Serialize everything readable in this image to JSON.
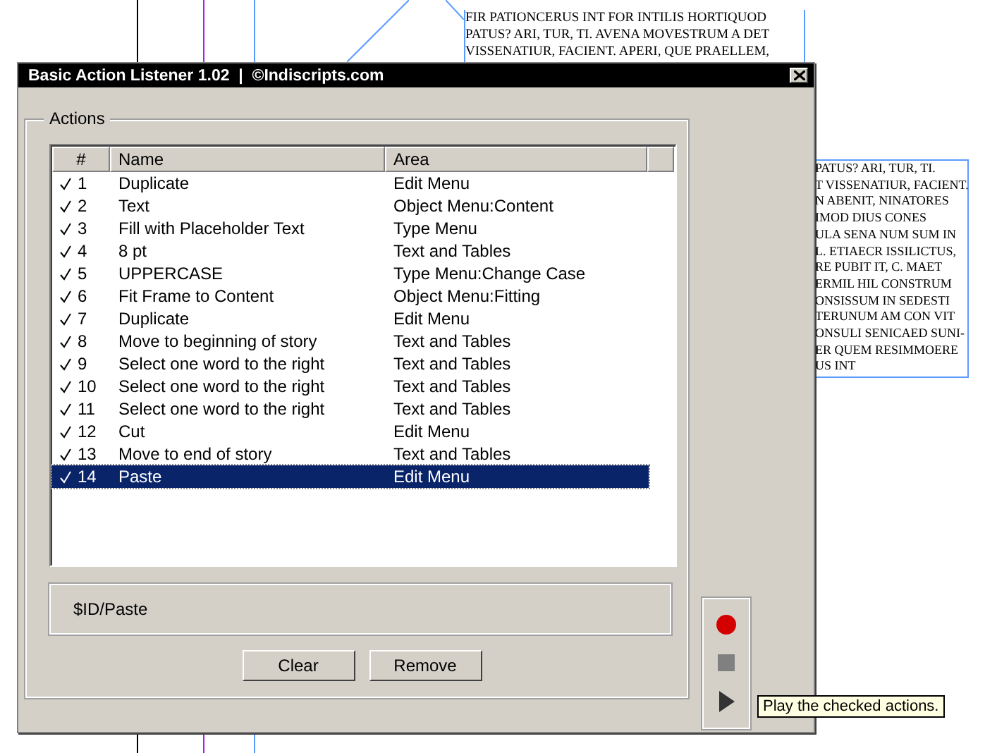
{
  "canvas": {
    "top_frame_lines": [
      "FIR PATIONCERUS INT FOR INTILIS HORTIQUOD",
      "PATUS? ARI, TUR, TI. AVENA MOVESTRUM A DET",
      "VISSENATIUR, FACIENT. APERI, QUE PRAELLEM,"
    ],
    "right_frame_lines": [
      "PATUS? ARI, TUR, TI.",
      "T VISSENATIUR, FACIENT.",
      "N ABENIT, NINATORES",
      "IMOD DIUS CONES",
      "ULA SENA NUM SUM IN",
      "L. ETIAECR ISSILICTUS,",
      "RE PUBIT IT, C. MAET",
      "ERMIL HIL CONSTRUM",
      "ONSISSUM IN SEDESTI",
      "TERUNUM AM CON VIT",
      "ONSULI SENICAED SUNI-",
      "ER QUEM RESIMMOERE",
      "US INT"
    ]
  },
  "window": {
    "title": "Basic Action Listener 1.02  |  ©Indiscripts.com"
  },
  "group": {
    "label": "Actions"
  },
  "table": {
    "columns": [
      "#",
      "Name",
      "Area"
    ],
    "rows": [
      {
        "checked": true,
        "selected": false,
        "number": "1",
        "name": "Duplicate",
        "area": "Edit Menu"
      },
      {
        "checked": true,
        "selected": false,
        "number": "2",
        "name": "Text",
        "area": "Object Menu:Content"
      },
      {
        "checked": true,
        "selected": false,
        "number": "3",
        "name": "Fill with Placeholder Text",
        "area": "Type Menu"
      },
      {
        "checked": true,
        "selected": false,
        "number": "4",
        "name": "8 pt",
        "area": "Text and Tables"
      },
      {
        "checked": true,
        "selected": false,
        "number": "5",
        "name": "UPPERCASE",
        "area": "Type Menu:Change Case"
      },
      {
        "checked": true,
        "selected": false,
        "number": "6",
        "name": "Fit Frame to Content",
        "area": "Object Menu:Fitting"
      },
      {
        "checked": true,
        "selected": false,
        "number": "7",
        "name": "Duplicate",
        "area": "Edit Menu"
      },
      {
        "checked": true,
        "selected": false,
        "number": "8",
        "name": "Move to beginning of story",
        "area": "Text and Tables"
      },
      {
        "checked": true,
        "selected": false,
        "number": "9",
        "name": "Select one word to the right",
        "area": "Text and Tables"
      },
      {
        "checked": true,
        "selected": false,
        "number": "10",
        "name": "Select one word to the right",
        "area": "Text and Tables"
      },
      {
        "checked": true,
        "selected": false,
        "number": "11",
        "name": "Select one word to the right",
        "area": "Text and Tables"
      },
      {
        "checked": true,
        "selected": false,
        "number": "12",
        "name": "Cut",
        "area": "Edit Menu"
      },
      {
        "checked": true,
        "selected": false,
        "number": "13",
        "name": "Move to end of story",
        "area": "Text and Tables"
      },
      {
        "checked": true,
        "selected": true,
        "number": "14",
        "name": "Paste",
        "area": "Edit Menu"
      }
    ]
  },
  "info": {
    "text": "$ID/Paste"
  },
  "buttons": [
    "Clear",
    "Remove"
  ],
  "tooltip": {
    "text": "Play the checked actions."
  }
}
